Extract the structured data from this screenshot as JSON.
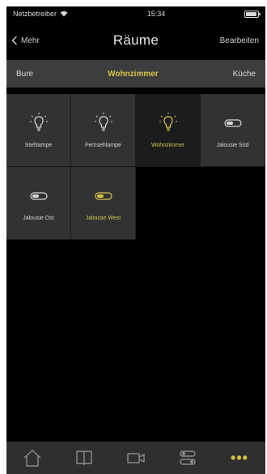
{
  "statusbar": {
    "carrier": "Netzbetreiber",
    "time": "15:34",
    "battery_level": 0.9
  },
  "nav": {
    "back_label": "Mehr",
    "title": "Räume",
    "edit_label": "Bearbeiten"
  },
  "rooms": {
    "prev": "Bure",
    "current": "Wohnzimmer",
    "next": "Küche"
  },
  "tiles": [
    {
      "label": "Stehlampe",
      "icon": "bulb-icon",
      "on": false
    },
    {
      "label": "Fernsehlampe",
      "icon": "bulb-icon",
      "on": false
    },
    {
      "label": "Wohnzimmer",
      "icon": "bulb-icon",
      "on": true
    },
    {
      "label": "Jalousie Süd",
      "icon": "switch-icon",
      "on": false
    },
    {
      "label": "Jalousie Ost",
      "icon": "switch-icon",
      "on": false
    },
    {
      "label": "Jalousie West",
      "icon": "switch-icon",
      "on": true
    }
  ],
  "tabs": [
    "home-icon",
    "book-icon",
    "camera-icon",
    "sliders-icon",
    "more-icon"
  ],
  "colors": {
    "accent": "#d8c34a",
    "tile": "#323232",
    "bar": "#3d3d3d",
    "tabbar": "#2f2f2f"
  }
}
